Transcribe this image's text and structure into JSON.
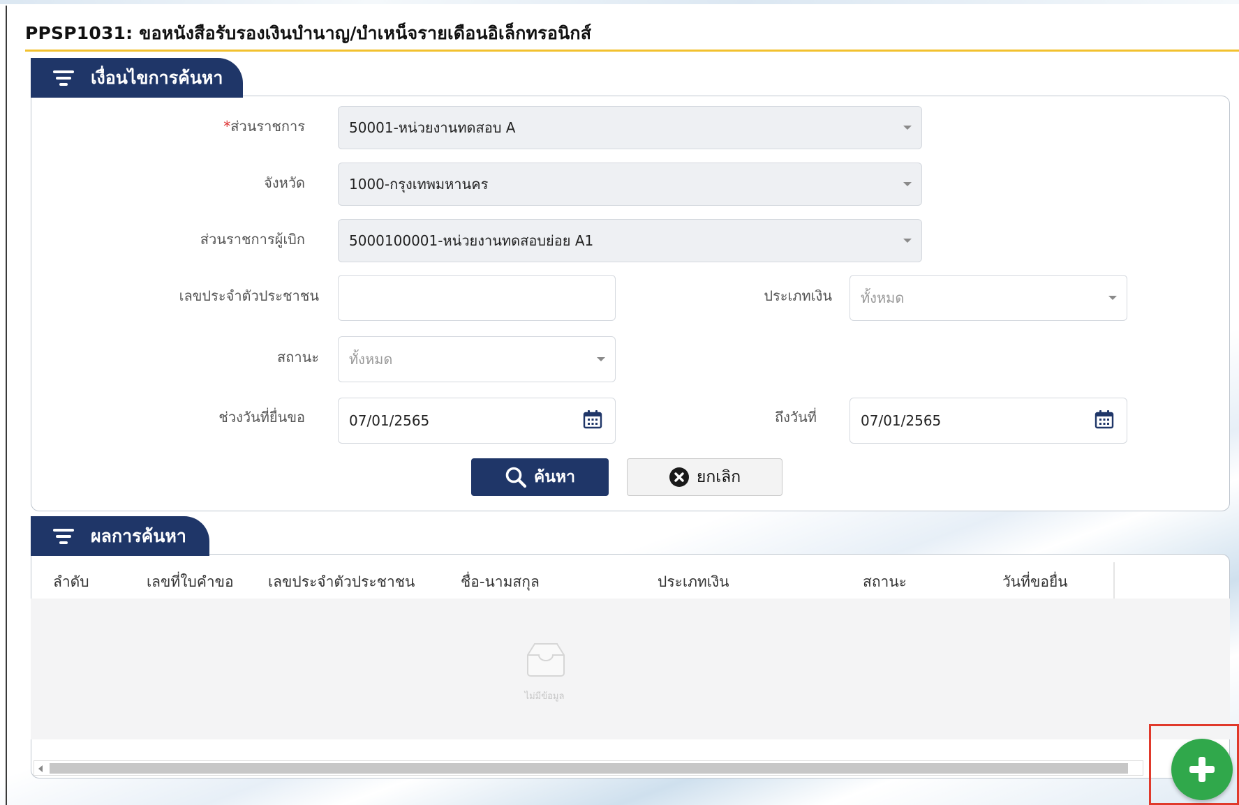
{
  "page": {
    "title": "PPSP1031: ขอหนังสือรับรองเงินบำนาญ/บำเหน็จรายเดือนอิเล็กทรอนิกส์"
  },
  "search_section": {
    "title": "เงื่อนไขการค้นหา",
    "fields": {
      "agency": {
        "required_mark": "*",
        "label": "ส่วนราชการ",
        "value": "50001-หน่วยงานทดสอบ A"
      },
      "province": {
        "label": "จังหวัด",
        "value": "1000-กรุงเทพมหานคร"
      },
      "disbursing_agency": {
        "label": "ส่วนราชการผู้เบิก",
        "value": "5000100001-หน่วยงานทดสอบย่อย A1"
      },
      "citizen_id": {
        "label": "เลขประจำตัวประชาชน",
        "value": ""
      },
      "money_type": {
        "label": "ประเภทเงิน",
        "value": "ทั้งหมด"
      },
      "status": {
        "label": "สถานะ",
        "value": "ทั้งหมด"
      },
      "date_from": {
        "label": "ช่วงวันที่ยื่นขอ",
        "value": "07/01/2565"
      },
      "date_to": {
        "label": "ถึงวันที่",
        "value": "07/01/2565"
      }
    },
    "buttons": {
      "search": "ค้นหา",
      "cancel": "ยกเลิก"
    }
  },
  "results_section": {
    "title": "ผลการค้นหา",
    "columns": [
      "ลำดับ",
      "เลขที่ใบคำขอ",
      "เลขประจำตัวประชาชน",
      "ชื่อ-นามสกุล",
      "ประเภทเงิน",
      "สถานะ",
      "วันที่ขอยื่น"
    ],
    "rows": [],
    "empty_text": "ไม่มีข้อมูล"
  },
  "colors": {
    "primary": "#1f3668",
    "accent_line": "#f2c12e",
    "fab": "#30a84b",
    "highlight": "#e0392b"
  },
  "icons": {
    "section": "filter-icon",
    "search": "magnifier-icon",
    "cancel": "close-circle-icon",
    "date": "calendar-icon",
    "add": "plus-icon"
  }
}
